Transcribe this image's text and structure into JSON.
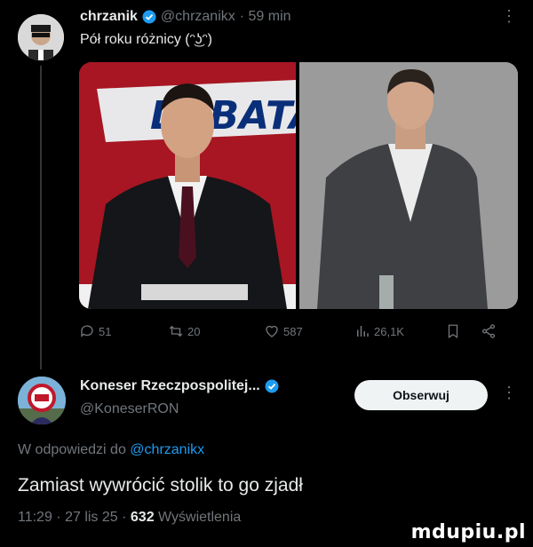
{
  "tweet": {
    "author_name": "chrzanik",
    "author_handle": "@chrzanikx",
    "time": "· 59 min",
    "more": "⋮",
    "text": "Pół roku różnicy (ᵔ͜ʖᵔ)",
    "media_text": "DEBATA",
    "actions": {
      "replies": "51",
      "retweets": "20",
      "likes": "587",
      "views": "26,1K"
    }
  },
  "reply": {
    "author_name": "Koneser Rzeczpospolitej...",
    "author_handle": "@KoneserRON",
    "follow_label": "Obserwuj",
    "more": "⋮",
    "reply_prefix": "W odpowiedzi do",
    "reply_mention": "@chrzanikx",
    "text": "Zamiast wywrócić stolik to go zjadł",
    "meta_time": "11:29 · 27 lis 25 ·",
    "meta_views": "632",
    "meta_views_label": "Wyświetlenia"
  },
  "watermark": "mdupiu.pl",
  "colors": {
    "accent": "#1d9bf0",
    "muted": "#71767b",
    "text": "#e7e9ea"
  }
}
